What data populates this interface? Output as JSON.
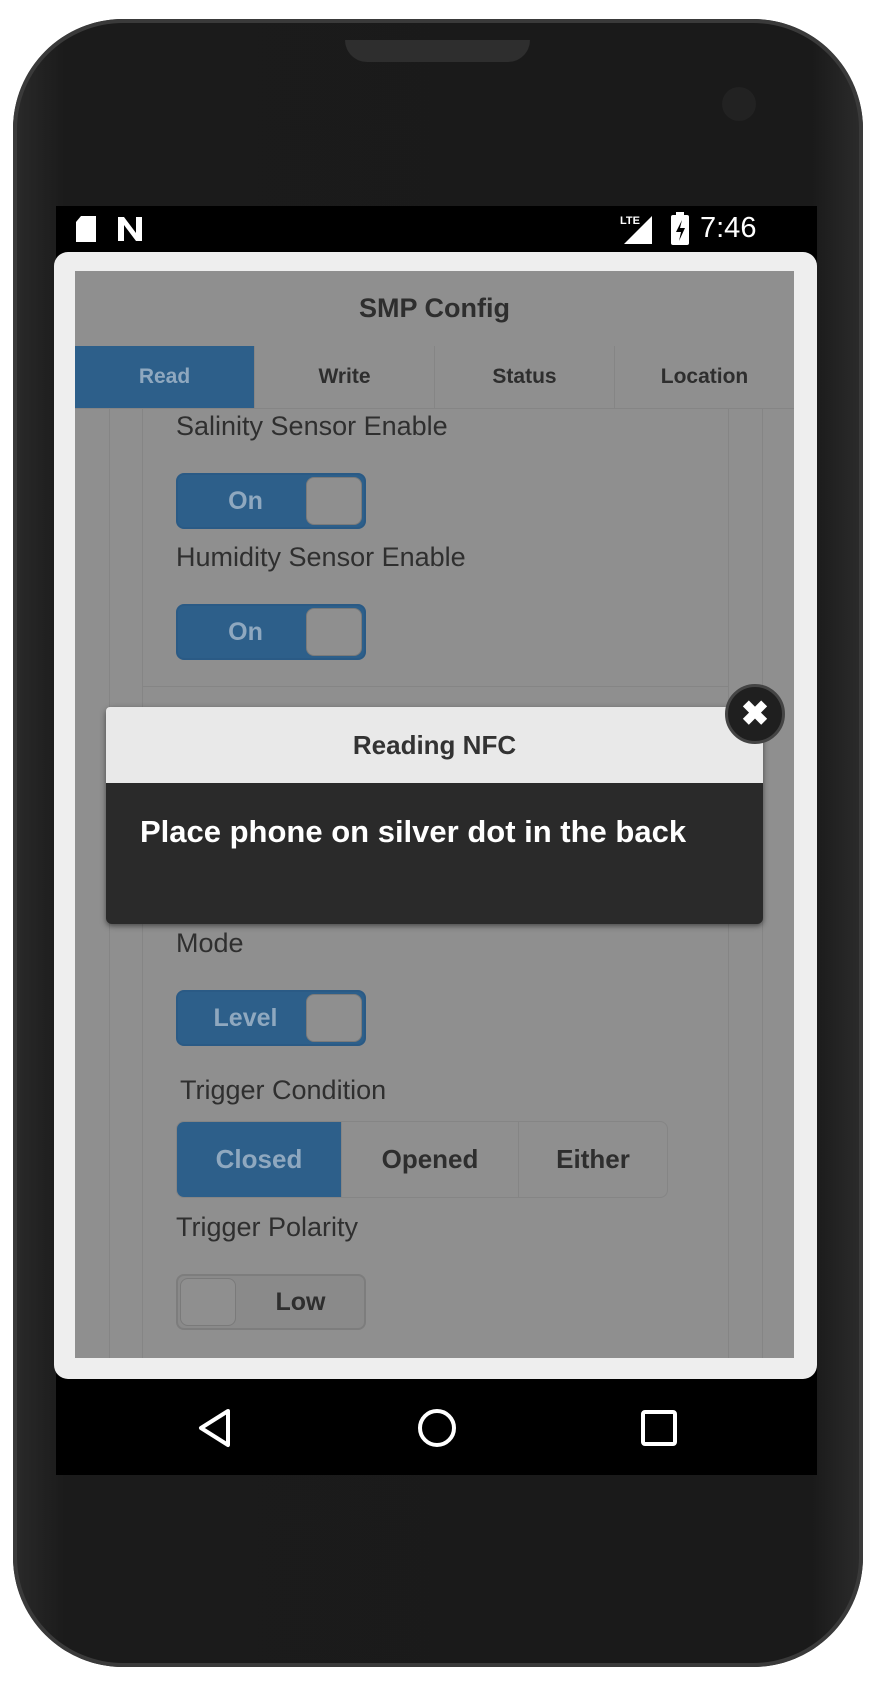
{
  "status_bar": {
    "time": "7:46",
    "network": "LTE",
    "icons": [
      "sd-card-icon",
      "n-notification-icon",
      "lte-signal-icon",
      "battery-charging-icon"
    ]
  },
  "app": {
    "title": "SMP Config",
    "tabs": [
      {
        "label": "Read",
        "active": true
      },
      {
        "label": "Write",
        "active": false
      },
      {
        "label": "Status",
        "active": false
      },
      {
        "label": "Location",
        "active": false
      }
    ],
    "fields": {
      "salinity": {
        "label": "Salinity Sensor Enable",
        "value": "On",
        "state": true
      },
      "humidity": {
        "label": "Humidity Sensor Enable",
        "value": "On",
        "state": true
      },
      "mode": {
        "label": "Mode",
        "value": "Level",
        "state": true
      },
      "trigger_condition": {
        "label": "Trigger Condition",
        "options": [
          "Closed",
          "Opened",
          "Either"
        ],
        "selected": "Closed"
      },
      "trigger_polarity": {
        "label": "Trigger Polarity",
        "value": "Low",
        "state": false
      }
    }
  },
  "dialog": {
    "title": "Reading NFC",
    "message": "Place phone on silver dot in the back",
    "close_icon": "close-icon"
  },
  "nav": {
    "icons": [
      "back-icon",
      "home-icon",
      "recents-icon"
    ]
  },
  "colors": {
    "accent": "#2d5f8a",
    "overlay": "#8f8f8f",
    "dialog_body": "#2a2a2a",
    "dialog_header": "#e9e9e9"
  }
}
